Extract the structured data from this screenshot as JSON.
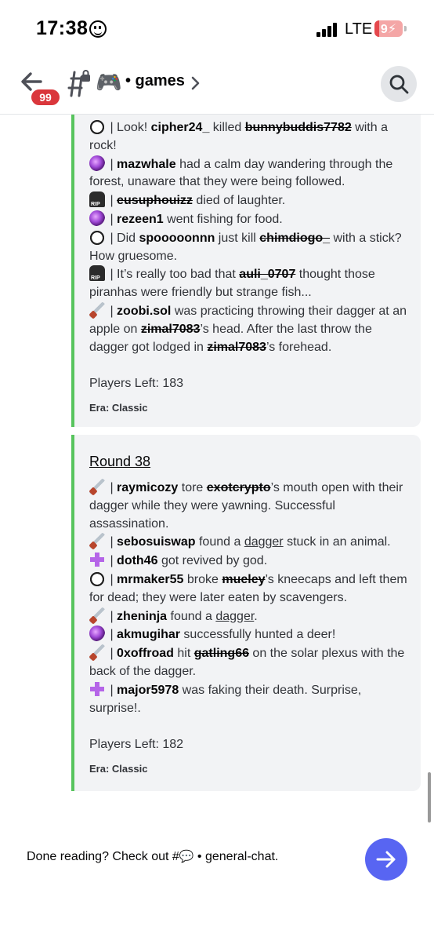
{
  "status": {
    "time": "17:38",
    "network": "LTE",
    "battery": "9"
  },
  "header": {
    "badge": "99",
    "channel_emoji": "🎮",
    "channel_name": "• games"
  },
  "embed1": {
    "lines": [
      {
        "pre": " | Look! ",
        "user": "cipher24_",
        "mid": " killed ",
        "victim": "bunnybuddis7782",
        "post": " with a rock!"
      },
      {
        "user": "mazwhale",
        "post": " had a calm day wandering through the forest, unaware that they were being followed."
      },
      {
        "victim": "eusuphouizz",
        "post": " died of laughter."
      },
      {
        "user": "rezeen1",
        "post": " went fishing for food."
      },
      {
        "pre": " | Did ",
        "user": "spooooonnn",
        "mid": " just kill ",
        "victim": "chimdiogo_",
        "post": " with a stick? How gruesome."
      },
      {
        "pre": " | It’s really too bad that ",
        "victim": "auli_0707",
        "post": " thought those piranhas were friendly but strange fish..."
      },
      {
        "user": "zoobi.sol",
        "mid": " was practicing throwing their dagger at an apple on ",
        "victim": "zimal7083",
        "mid2": "’s head. After the last throw the dagger got lodged in ",
        "victim2": "zimal7083",
        "post": "’s forehead."
      }
    ],
    "players_left": "Players Left: 183",
    "era": "Era: Classic"
  },
  "embed2": {
    "title": "Round 38",
    "lines": [
      {
        "user": "raymicozy",
        "mid": " tore ",
        "victim": "exotcrypto",
        "post": "’s mouth open with their dagger while they were yawning. Successful assassination."
      },
      {
        "user": "sebosuiswap",
        "mid": " found a ",
        "link": "dagger",
        "post": " stuck in an animal."
      },
      {
        "user": "doth46",
        "post": " got revived by god."
      },
      {
        "user": "mrmaker55",
        "mid": " broke ",
        "victim": "mueley",
        "post": "’s kneecaps and left them for dead; they were later eaten by scavengers."
      },
      {
        "user": "zheninja",
        "mid": " found a ",
        "link": "dagger",
        "post": "."
      },
      {
        "user": "akmugihar",
        "post": " successfully hunted a deer!"
      },
      {
        "user": "0xoffroad",
        "mid": " hit ",
        "victim": "gatling66",
        "post": " on the solar plexus with the back of the dagger."
      },
      {
        "user": "major5978",
        "post": " was faking their death. Surprise, surprise!."
      }
    ],
    "players_left": "Players Left: 182",
    "era": "Era: Classic"
  },
  "footer": {
    "text_before": "Done reading? Check out #",
    "bubble": "💬",
    "text_after": " • general-chat."
  },
  "colors": {
    "accent": "#5865f2",
    "embed_bar": "#57c45d",
    "badge": "#da373c"
  }
}
